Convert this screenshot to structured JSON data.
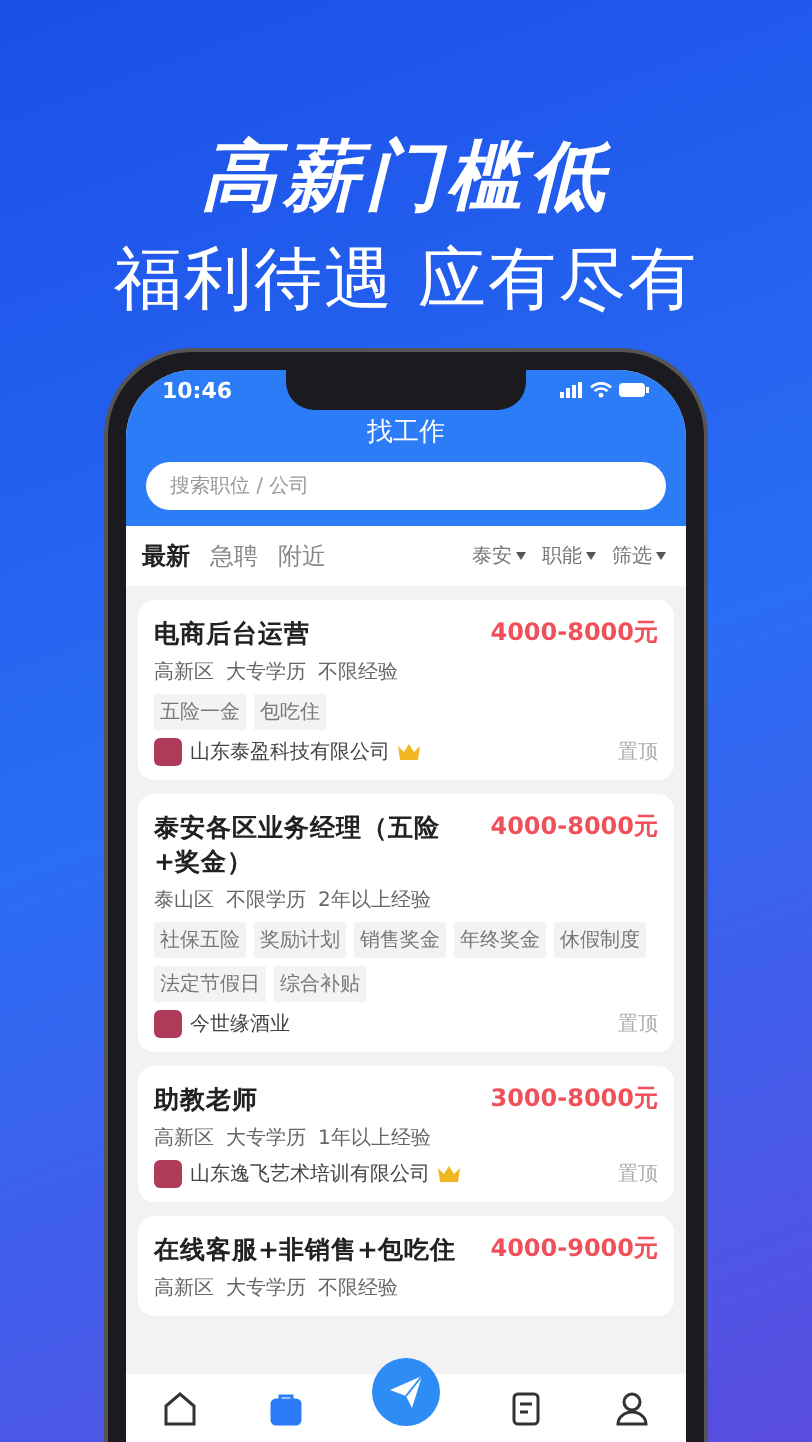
{
  "headline": "高薪门槛低",
  "subheadline": "福利待遇 应有尽有",
  "status_bar": {
    "time": "10:46"
  },
  "header": {
    "title": "找工作"
  },
  "search": {
    "placeholder": "搜索职位 / 公司"
  },
  "tabs": [
    {
      "label": "最新",
      "selected": true
    },
    {
      "label": "急聘",
      "selected": false
    },
    {
      "label": "附近",
      "selected": false
    }
  ],
  "filters": [
    "泰安",
    "职能",
    "筛选"
  ],
  "jobs": [
    {
      "title": "电商后台运营",
      "salary": "4000-8000元",
      "meta": [
        "高新区",
        "大专学历",
        "不限经验"
      ],
      "tags": [
        "五险一金",
        "包吃住"
      ],
      "company": "山东泰盈科技有限公司",
      "vip": true,
      "pin": "置顶"
    },
    {
      "title": "泰安各区业务经理（五险+奖金）",
      "salary": "4000-8000元",
      "meta": [
        "泰山区",
        "不限学历",
        "2年以上经验"
      ],
      "tags": [
        "社保五险",
        "奖励计划",
        "销售奖金",
        "年终奖金",
        "休假制度",
        "法定节假日",
        "综合补贴"
      ],
      "company": "今世缘酒业",
      "vip": false,
      "pin": "置顶"
    },
    {
      "title": "助教老师",
      "salary": "3000-8000元",
      "meta": [
        "高新区",
        "大专学历",
        "1年以上经验"
      ],
      "company": "山东逸飞艺术培训有限公司",
      "vip": true,
      "pin": "置顶"
    },
    {
      "title": "在线客服+非销售+包吃住",
      "salary": "4000-9000元",
      "meta": [
        "高新区",
        "大专学历",
        "不限经验"
      ]
    }
  ],
  "tab_bar": [
    {
      "kind": "home",
      "selected": false
    },
    {
      "kind": "bag",
      "selected": true
    },
    {
      "kind": "send",
      "selected": false
    },
    {
      "kind": "resume",
      "selected": false
    },
    {
      "kind": "person",
      "selected": false
    }
  ]
}
